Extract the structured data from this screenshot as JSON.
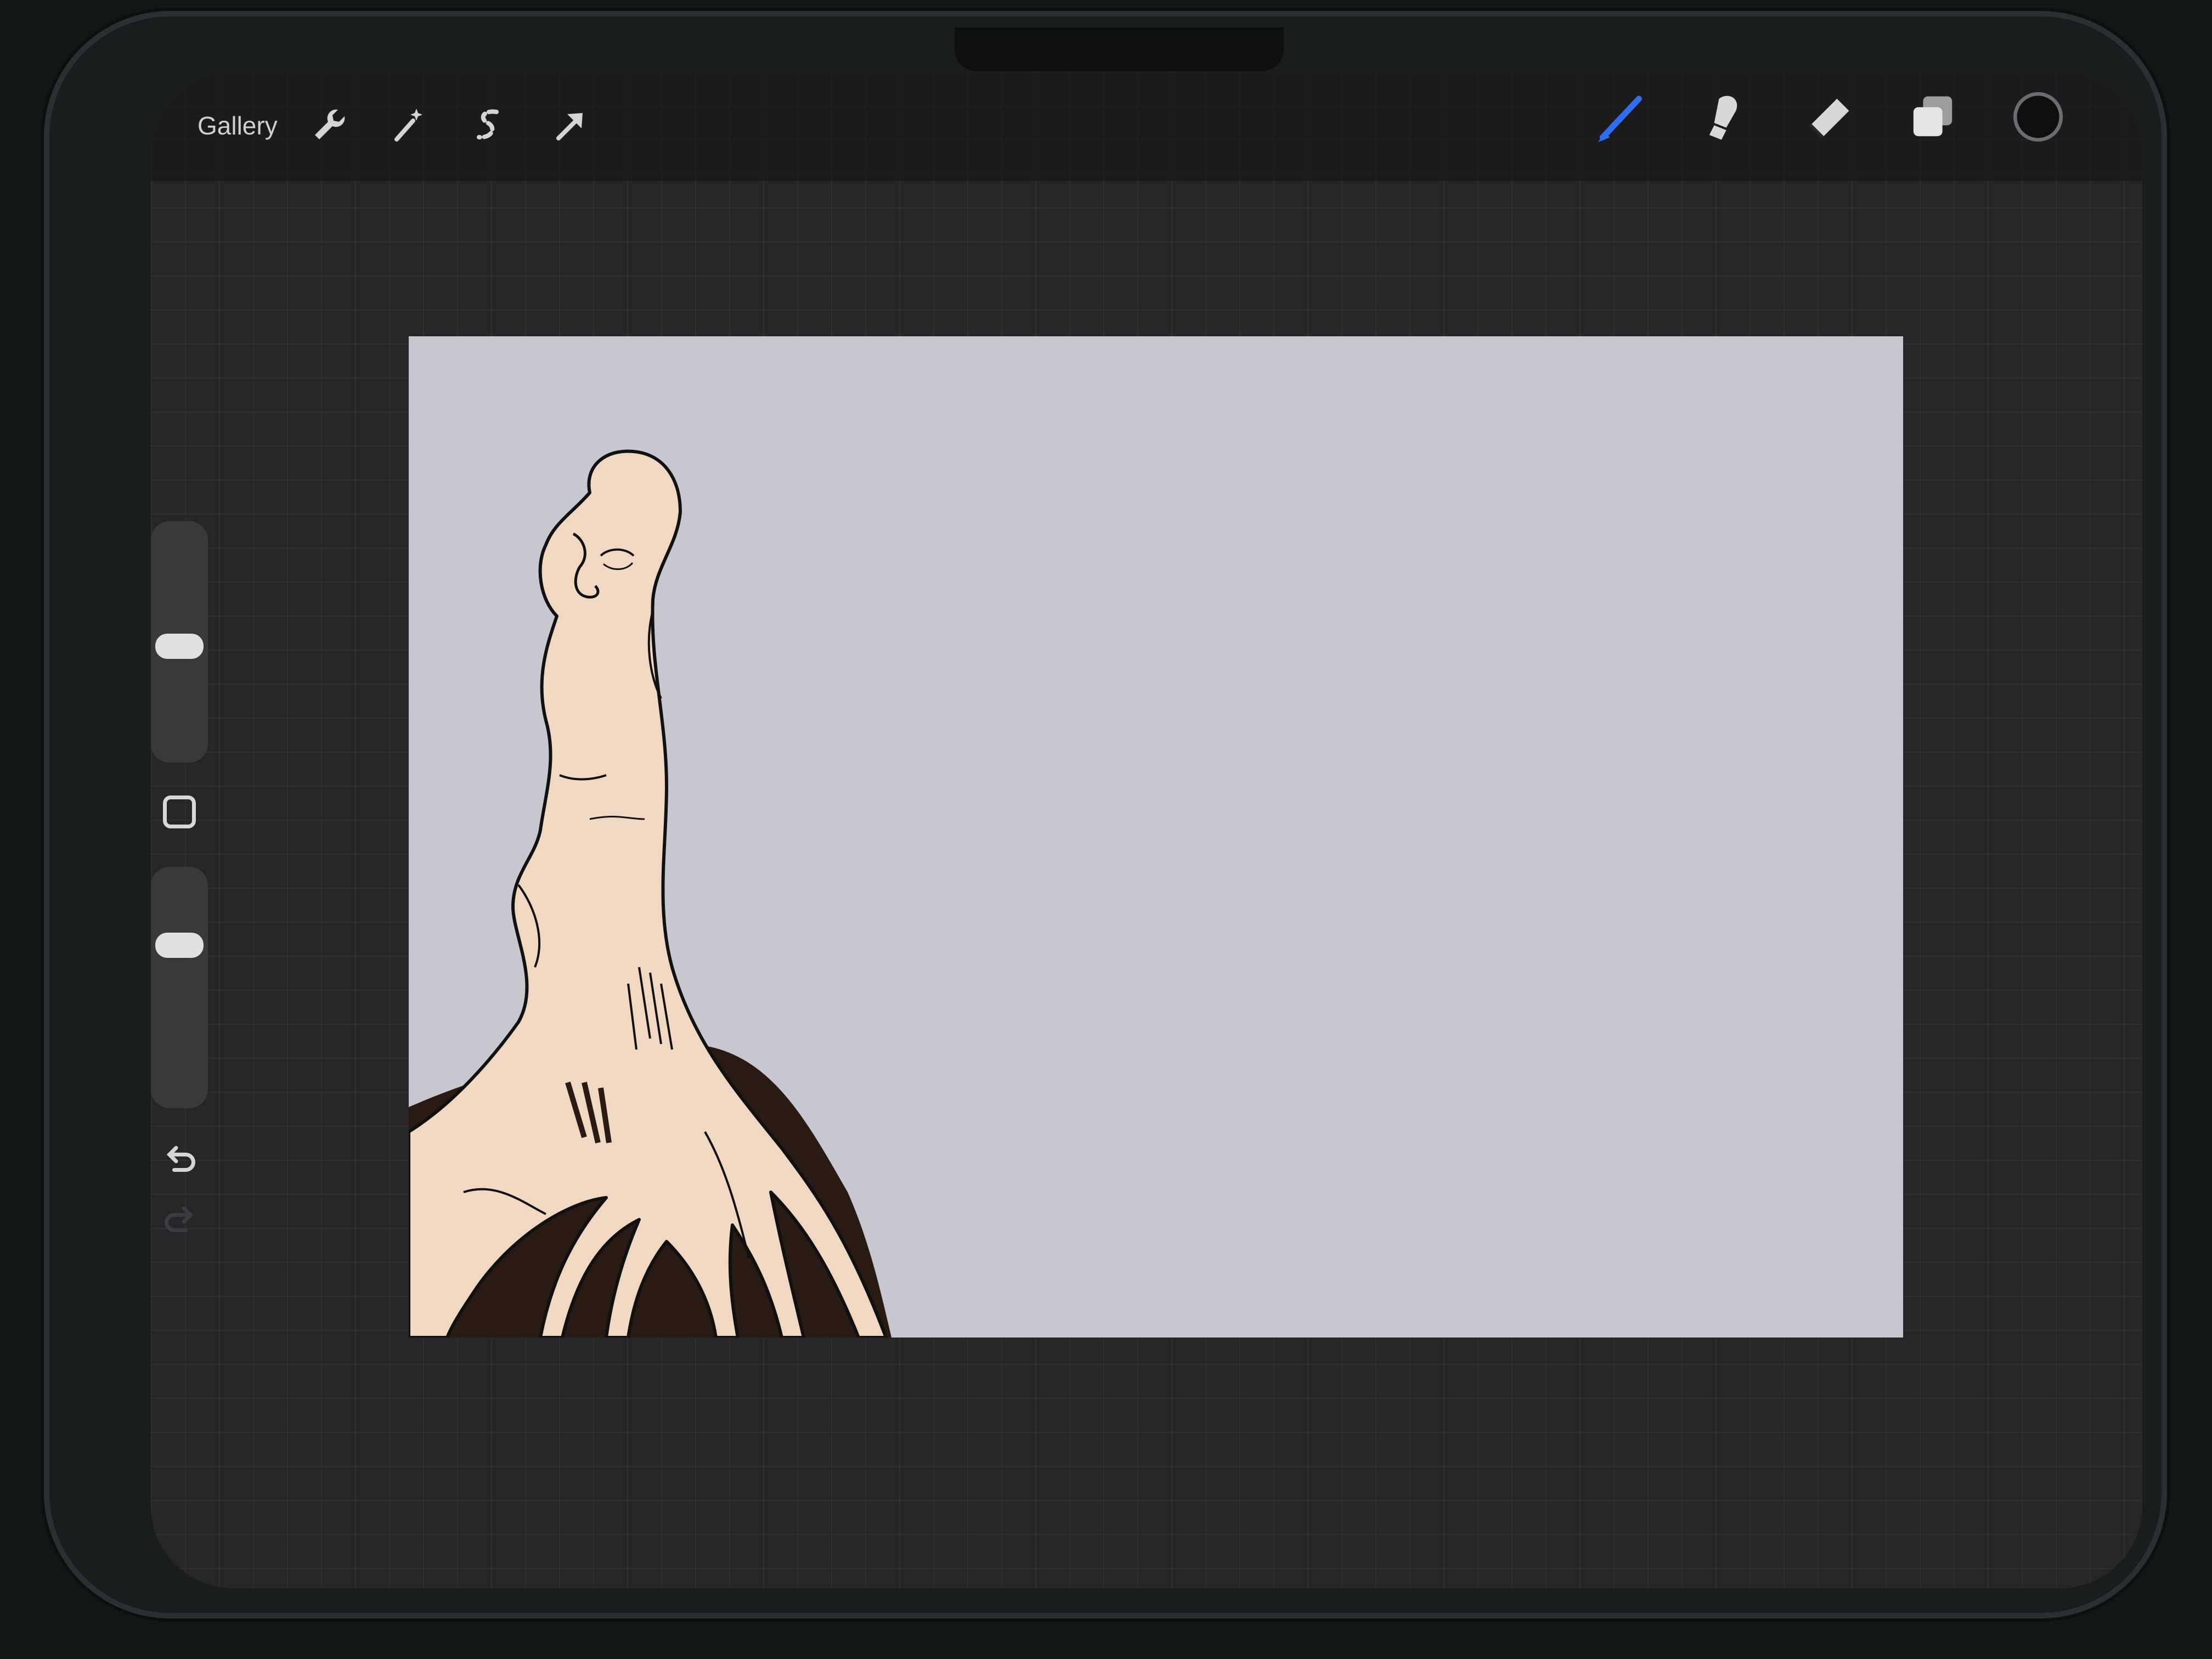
{
  "toolbar": {
    "gallery_label": "Gallery",
    "left_tools": [
      "wrench-icon",
      "magic-wand-icon",
      "selection-icon",
      "transform-arrow-icon"
    ],
    "right_tools": [
      "brush-icon",
      "smudge-icon",
      "eraser-icon",
      "layers-icon",
      "color-swatch"
    ],
    "active_tool": "brush",
    "active_color": "#2f6cf0",
    "current_color": "#0f0f10"
  },
  "sidebar": {
    "brush_size_level": 0.45,
    "opacity_level": 0.4,
    "controls": [
      "brush-size-slider",
      "modify-button",
      "opacity-slider",
      "undo-button",
      "redo-button"
    ]
  },
  "canvas": {
    "background_color": "#c7c8cf",
    "artwork": {
      "subject": "tree-trunk-figure-with-face",
      "fill_color": "#f1d8c2",
      "soil_color": "#2a1a14",
      "line_color": "#111111"
    }
  }
}
